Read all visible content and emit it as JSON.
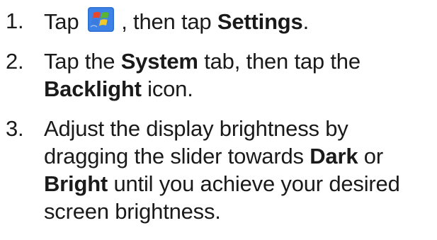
{
  "steps": [
    {
      "number": "1.",
      "parts": {
        "a": "Tap ",
        "icon": "windows-start-icon",
        "b": " , then tap ",
        "c": "Settings",
        "d": "."
      }
    },
    {
      "number": "2.",
      "parts": {
        "a": "Tap the ",
        "b": "System",
        "c": " tab, then tap the",
        "d": "Backlight",
        "e": " icon."
      }
    },
    {
      "number": "3.",
      "parts": {
        "a": "Adjust the display brightness by",
        "b": "dragging the slider towards ",
        "c": "Dark",
        "d": " or",
        "e": "Bright",
        "f": " until you achieve your desired",
        "g": "screen brightness."
      }
    }
  ],
  "colors": {
    "text": "#1a1a1a",
    "icon_background": "#2f6fd1",
    "icon_flag_red": "#e8472b",
    "icon_flag_green": "#5cb531",
    "icon_flag_blue": "#3a7be0",
    "icon_flag_yellow": "#f2c92a"
  }
}
